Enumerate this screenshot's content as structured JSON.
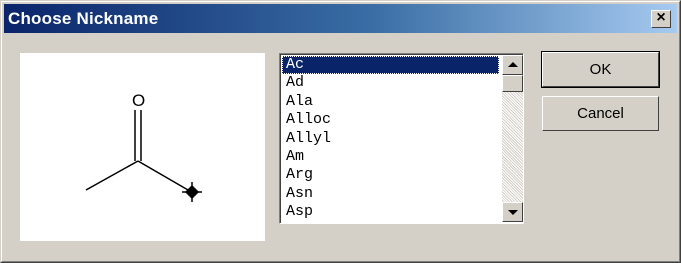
{
  "dialog": {
    "title": "Choose Nickname",
    "close_label": "×"
  },
  "structure": {
    "atom_label": "O"
  },
  "nickname_list": {
    "selected": "Ac",
    "items": [
      "Ac",
      "Ad",
      "Ala",
      "Alloc",
      "Allyl",
      "Am",
      "Arg",
      "Asn",
      "Asp"
    ]
  },
  "buttons": {
    "ok_label": "OK",
    "cancel_label": "Cancel"
  },
  "colors": {
    "title_bar_start": "#0a246a",
    "selection": "#0a246a",
    "face": "#d4d0c8"
  }
}
